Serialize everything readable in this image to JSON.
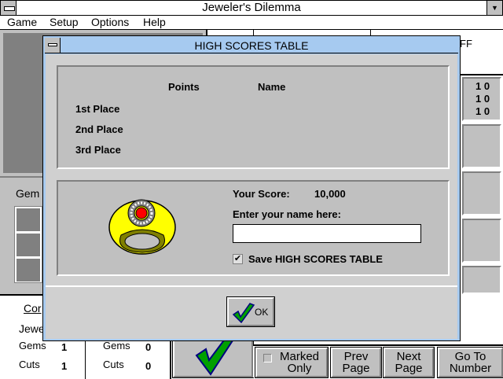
{
  "window": {
    "title": "Jeweler's Dilemma"
  },
  "menu": [
    "Game",
    "Setup",
    "Options",
    "Help"
  ],
  "background": {
    "top_right_text": "FF",
    "right_values": [
      "1 0",
      "1 0",
      "1 0"
    ],
    "gem_label": "Gem",
    "left_heading": "Cor",
    "left_row1": "Jewe",
    "col1": {
      "gems_label": "Gems",
      "gems": "1",
      "cuts_label": "Cuts",
      "cuts": "1"
    },
    "col2": {
      "gems_label": "Gems",
      "gems": "0",
      "cuts_label": "Cuts",
      "cuts": "0"
    },
    "buttons": {
      "marked_only": "Marked Only",
      "prev_page": "Prev Page",
      "next_page": "Next Page",
      "go_to_number": "Go To Number"
    }
  },
  "dialog": {
    "title": "HIGH SCORES TABLE",
    "headers": {
      "points": "Points",
      "name": "Name"
    },
    "places": [
      {
        "label": "1st Place",
        "points": "",
        "name": ""
      },
      {
        "label": "2nd Place",
        "points": "",
        "name": ""
      },
      {
        "label": "3rd Place",
        "points": "",
        "name": ""
      }
    ],
    "your_score_label": "Your Score:",
    "your_score": "10,000",
    "name_prompt": "Enter your name here:",
    "name_value": "",
    "save_label": "Save HIGH SCORES TABLE",
    "save_checked": true,
    "ok_label": "OK"
  },
  "colors": {
    "dialog_title": "#a6caf0",
    "ring_gold": "#ffff00",
    "ruby": "#ff0000",
    "check_green": "#00a000"
  }
}
